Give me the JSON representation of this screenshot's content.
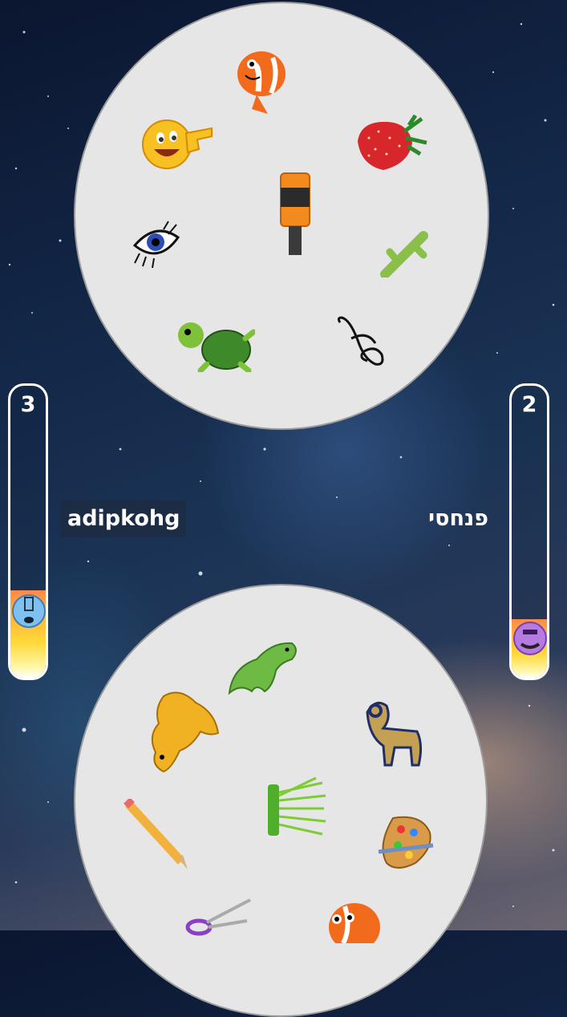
{
  "players": {
    "left": {
      "name": "adipkohg",
      "score": "3",
      "progress": 0.3
    },
    "right": {
      "name": "פנחסי",
      "score": "2",
      "progress": 0.2
    }
  },
  "top_card": {
    "symbols": [
      "clownfish-icon",
      "pointing-emoji-icon",
      "strawberry-icon",
      "bottle-icon",
      "eye-icon",
      "cactus-icon",
      "turtle-icon",
      "treble-clef-icon"
    ]
  },
  "bottom_card": {
    "symbols": [
      "dinosaur-icon",
      "dog-icon",
      "ram-icon",
      "pencil-icon",
      "grass-icon",
      "paint-palette-icon",
      "scissors-icon",
      "clownfish-icon"
    ]
  },
  "colors": {
    "card": "#e6e6e6",
    "meter_border": "#ffffff",
    "meter_fill_top": "#ff8a4a",
    "meter_fill_bottom": "#fff6a8"
  }
}
